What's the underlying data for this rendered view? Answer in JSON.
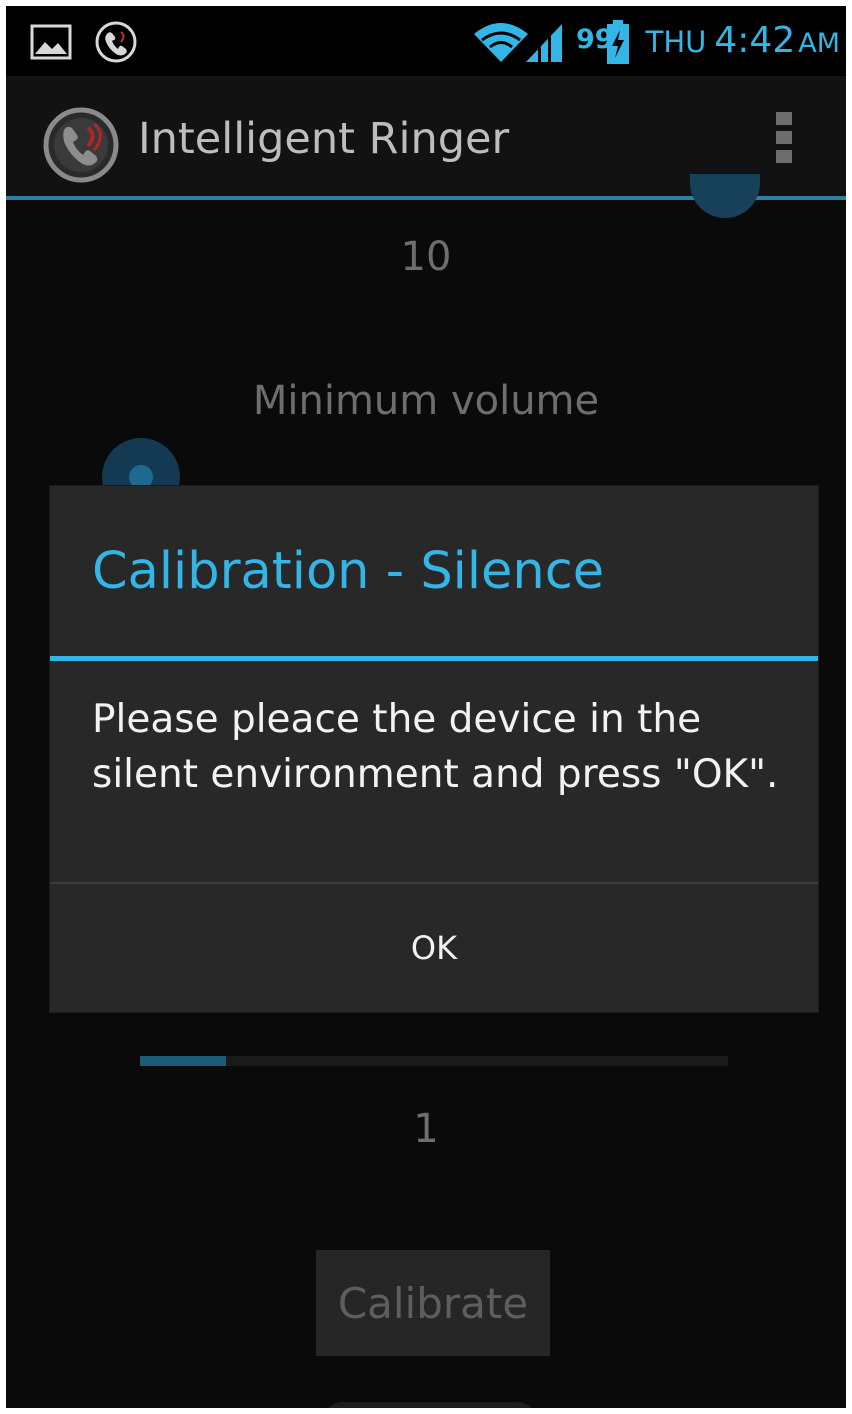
{
  "status_bar": {
    "day": "THU",
    "time": "4:42",
    "ampm": "AM",
    "battery_level": "99",
    "icons": [
      "picture-icon",
      "intelligent-ringer-notification-icon",
      "wifi-icon",
      "signal-icon",
      "battery-icon"
    ],
    "accent_color": "#33b5e5"
  },
  "action_bar": {
    "title": "Intelligent Ringer",
    "icon": "phone-speaker-icon",
    "menu_icon": "overflow-menu-icon"
  },
  "main": {
    "max_volume_value": "10",
    "min_volume_label": "Minimum volume",
    "min_volume_value": "1",
    "min_volume_slider_fraction": 0.1,
    "calibrate_label": "Calibrate"
  },
  "dialog": {
    "title": "Calibration - Silence",
    "message": "Please pleace the device in the silent environment and press \"OK\".",
    "ok_label": "OK"
  }
}
